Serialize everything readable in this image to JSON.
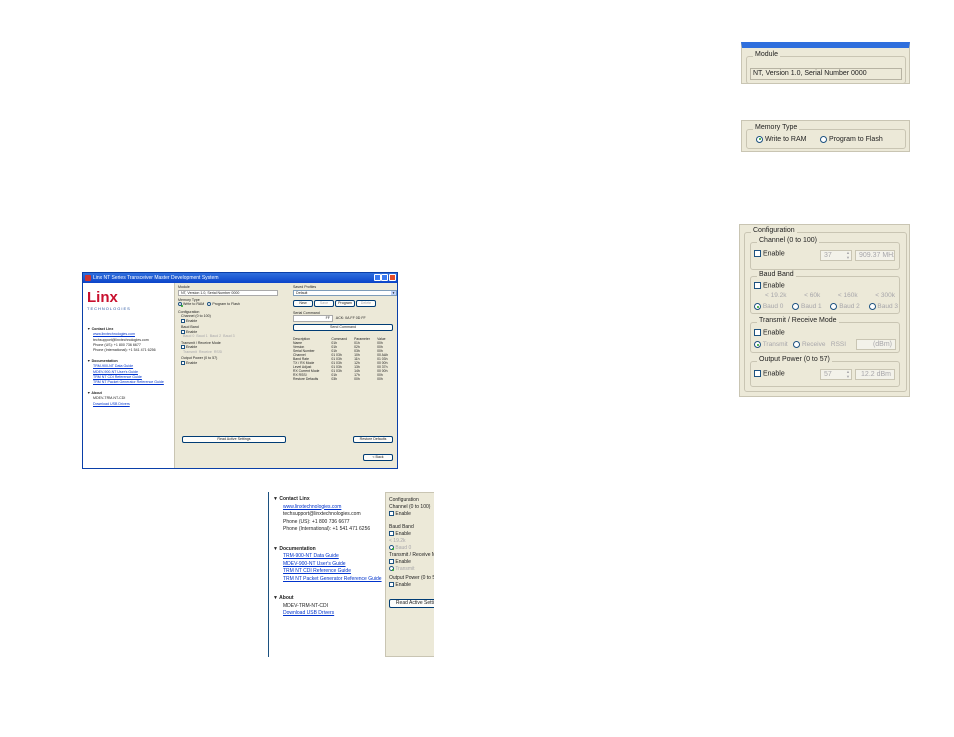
{
  "window": {
    "title": "Linx NT Series Transceiver Master Development System"
  },
  "logo": {
    "text": "Linx",
    "tagline": "TECHNOLOGIES"
  },
  "left": {
    "contact": {
      "heading": "Contact Linx",
      "web": "www.linxtechnologies.com",
      "email": "techsupport@linxtechnologies.com",
      "phone_us": "Phone (US): +1 800 736 6677",
      "phone_intl": "Phone (International): +1 541 471 6256"
    },
    "documentation": {
      "heading": "Documentation",
      "links": [
        "TRM-900-NT Data Guide",
        "MDEV-900-NT User's Guide",
        "TRM NT CDI Reference Guide",
        "TRM NT Packet Generator Reference Guide"
      ]
    },
    "about": {
      "heading": "About",
      "part": "MDEV-TRM-NT-CDI",
      "driver": "Download USB Drivers"
    }
  },
  "module": {
    "label": "Module",
    "value": "NT, Version 1.0, Serial Number 0000"
  },
  "memory": {
    "label": "Memory Type",
    "opt_ram": "Write to RAM",
    "opt_flash": "Program to Flash"
  },
  "config": {
    "label": "Configuration",
    "channel": {
      "label": "Channel (0 to 100)",
      "enable": "Enable",
      "value": "37",
      "freq": "909.37 MHz"
    },
    "baud": {
      "label": "Baud Band",
      "enable": "Enable",
      "rates": [
        "< 19.2k",
        "< 60k",
        "< 160k",
        "< 300k"
      ],
      "opts": [
        "Baud 0",
        "Baud 1",
        "Baud 2",
        "Baud 3"
      ]
    },
    "trx": {
      "label": "Transmit / Receive Mode",
      "enable": "Enable",
      "transmit": "Transmit",
      "receive": "Receive",
      "rssi": "RSSI",
      "unit": "(dBm)"
    },
    "power": {
      "label": "Output Power (0 to 57)",
      "enable": "Enable",
      "value": "57",
      "dbm": "12.2 dBm"
    },
    "read_btn": "Read Active Settings"
  },
  "saved": {
    "label": "Saved Profiles",
    "value": "Default",
    "new": "New",
    "save": "Save",
    "program": "Program",
    "delete": "Delete"
  },
  "serial": {
    "label": "Serial Command",
    "cmd": "FF",
    "ack": "ACK: 0A FF 0D FF",
    "send": "Send Command",
    "headers": [
      "Description",
      "Command",
      "Parameter",
      "Value"
    ],
    "rows": [
      [
        "Name",
        "01h",
        "01h",
        "00h"
      ],
      [
        "Version",
        "01h",
        "02h",
        "00h"
      ],
      [
        "Serial Number",
        "01h",
        "03h",
        "00h"
      ],
      [
        "Channel",
        "01 03h",
        "10h",
        "00 AAh"
      ],
      [
        "Band Rate",
        "01 03h",
        "11h",
        "01 03h"
      ],
      [
        "TX / RX Mode",
        "01 03h",
        "12h",
        "00 00h"
      ],
      [
        "Level Adjust",
        "01 03h",
        "13h",
        "00 37h"
      ],
      [
        "RX Current Mode",
        "01 03h",
        "14h",
        "00 00h"
      ],
      [
        "RX RSSI",
        "01h",
        "17h",
        "00h"
      ],
      [
        "Restore Defaults",
        "03h",
        "00h",
        "00h"
      ]
    ],
    "restore": "Restore Defaults",
    "back": "< Back"
  }
}
